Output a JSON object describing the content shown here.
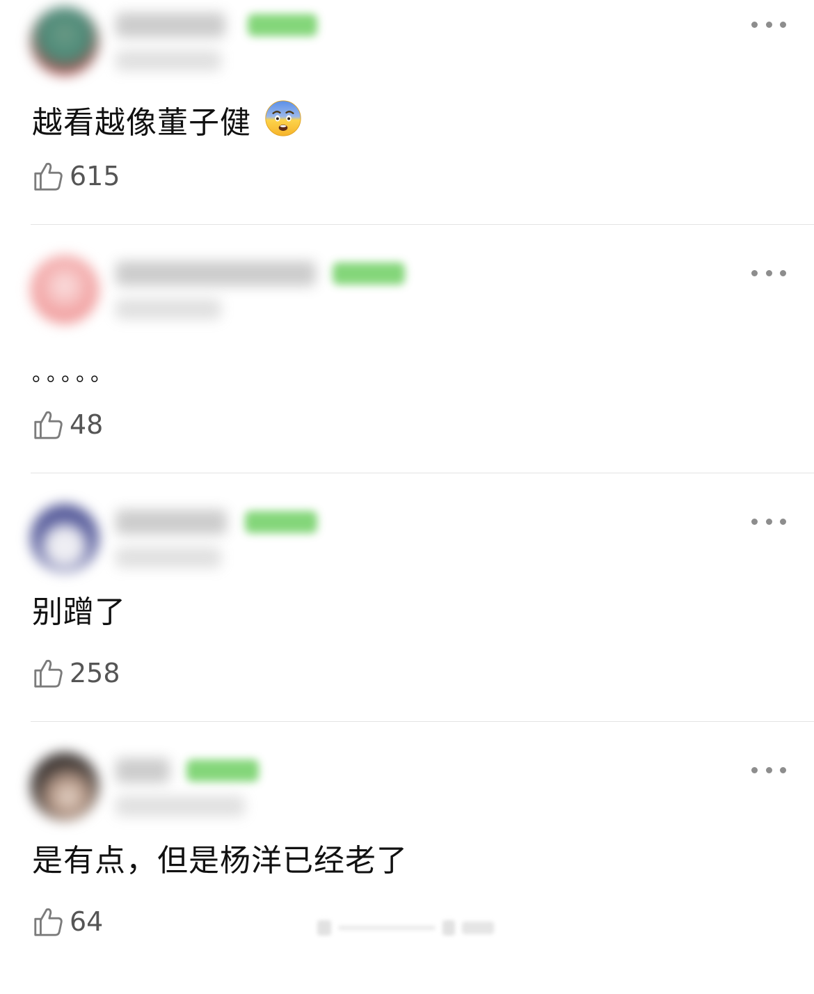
{
  "comments": [
    {
      "text": "越看越像董子健",
      "emoji": "fearful-face-emoji",
      "likes": "615",
      "avatar_color": "#4a8a78",
      "badge_color": "#6fcf63"
    },
    {
      "text": "。。。。。",
      "likes": "48",
      "avatar_color": "#f0a4a4",
      "badge_color": "#6fcf63"
    },
    {
      "text": "别蹭了",
      "likes": "258",
      "avatar_color": "#5a5f9e",
      "badge_color": "#7fd77a"
    },
    {
      "text": "是有点，但是杨洋已经老了",
      "likes": "64",
      "avatar_color": "#3c3532",
      "badge_color": "#7fd77a"
    }
  ],
  "icons": {
    "like": "thumbs-up-outline-icon",
    "more": "more-dots-icon"
  },
  "colors": {
    "divider": "#e3e3e3",
    "icon_gray": "#8d8d8d",
    "count_gray": "#555555",
    "text": "#111111"
  }
}
